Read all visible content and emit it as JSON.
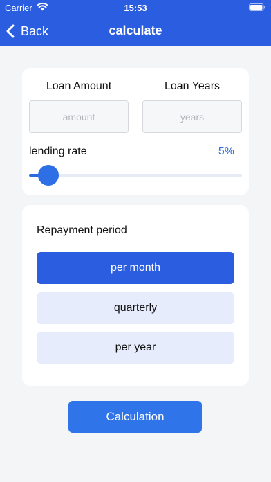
{
  "status_bar": {
    "carrier": "Carrier",
    "time": "15:53",
    "icons": [
      "wifi-icon",
      "battery-icon"
    ]
  },
  "nav": {
    "back_label": "Back",
    "title": "calculate",
    "back_icon": "chevron-left-icon"
  },
  "loan": {
    "amount_label": "Loan Amount",
    "amount_placeholder": "amount",
    "amount_value": "",
    "years_label": "Loan Years",
    "years_placeholder": "years",
    "years_value": ""
  },
  "rate": {
    "label": "lending rate",
    "value_text": "5%",
    "slider_fraction": 0.09
  },
  "period": {
    "title": "Repayment period",
    "options": [
      {
        "label": "per month",
        "selected": true
      },
      {
        "label": "quarterly",
        "selected": false
      },
      {
        "label": "per year",
        "selected": false
      }
    ]
  },
  "action": {
    "calculate_label": "Calculation"
  },
  "colors": {
    "header": "#2a5de0",
    "accent": "#2f74e8",
    "rate_text": "#2a6bdf",
    "option_selected": "#2a5de0",
    "option_unselected": "#e6ecfb",
    "background": "#f4f5f7"
  }
}
